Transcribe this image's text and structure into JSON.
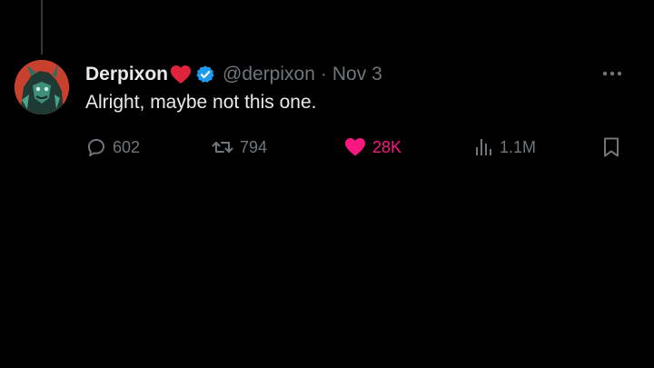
{
  "tweet": {
    "author_name": "Derpixon",
    "handle": "@derpixon",
    "separator": "·",
    "date": "Nov 3",
    "text": "Alright, maybe not this one."
  },
  "actions": {
    "replies": "602",
    "retweets": "794",
    "likes": "28K",
    "views": "1.1M"
  },
  "colors": {
    "background": "#000000",
    "text": "#e7e9ea",
    "muted": "#71767b",
    "verified": "#1d9bf0",
    "like": "#f91880",
    "heart_emoji": "#e0243b"
  },
  "icons": {
    "reply": "reply-icon",
    "retweet": "retweet-icon",
    "like": "heart-icon",
    "views": "views-icon",
    "bookmark": "bookmark-icon",
    "more": "more-icon",
    "verified": "verified-badge-icon"
  },
  "state": {
    "liked": true
  }
}
